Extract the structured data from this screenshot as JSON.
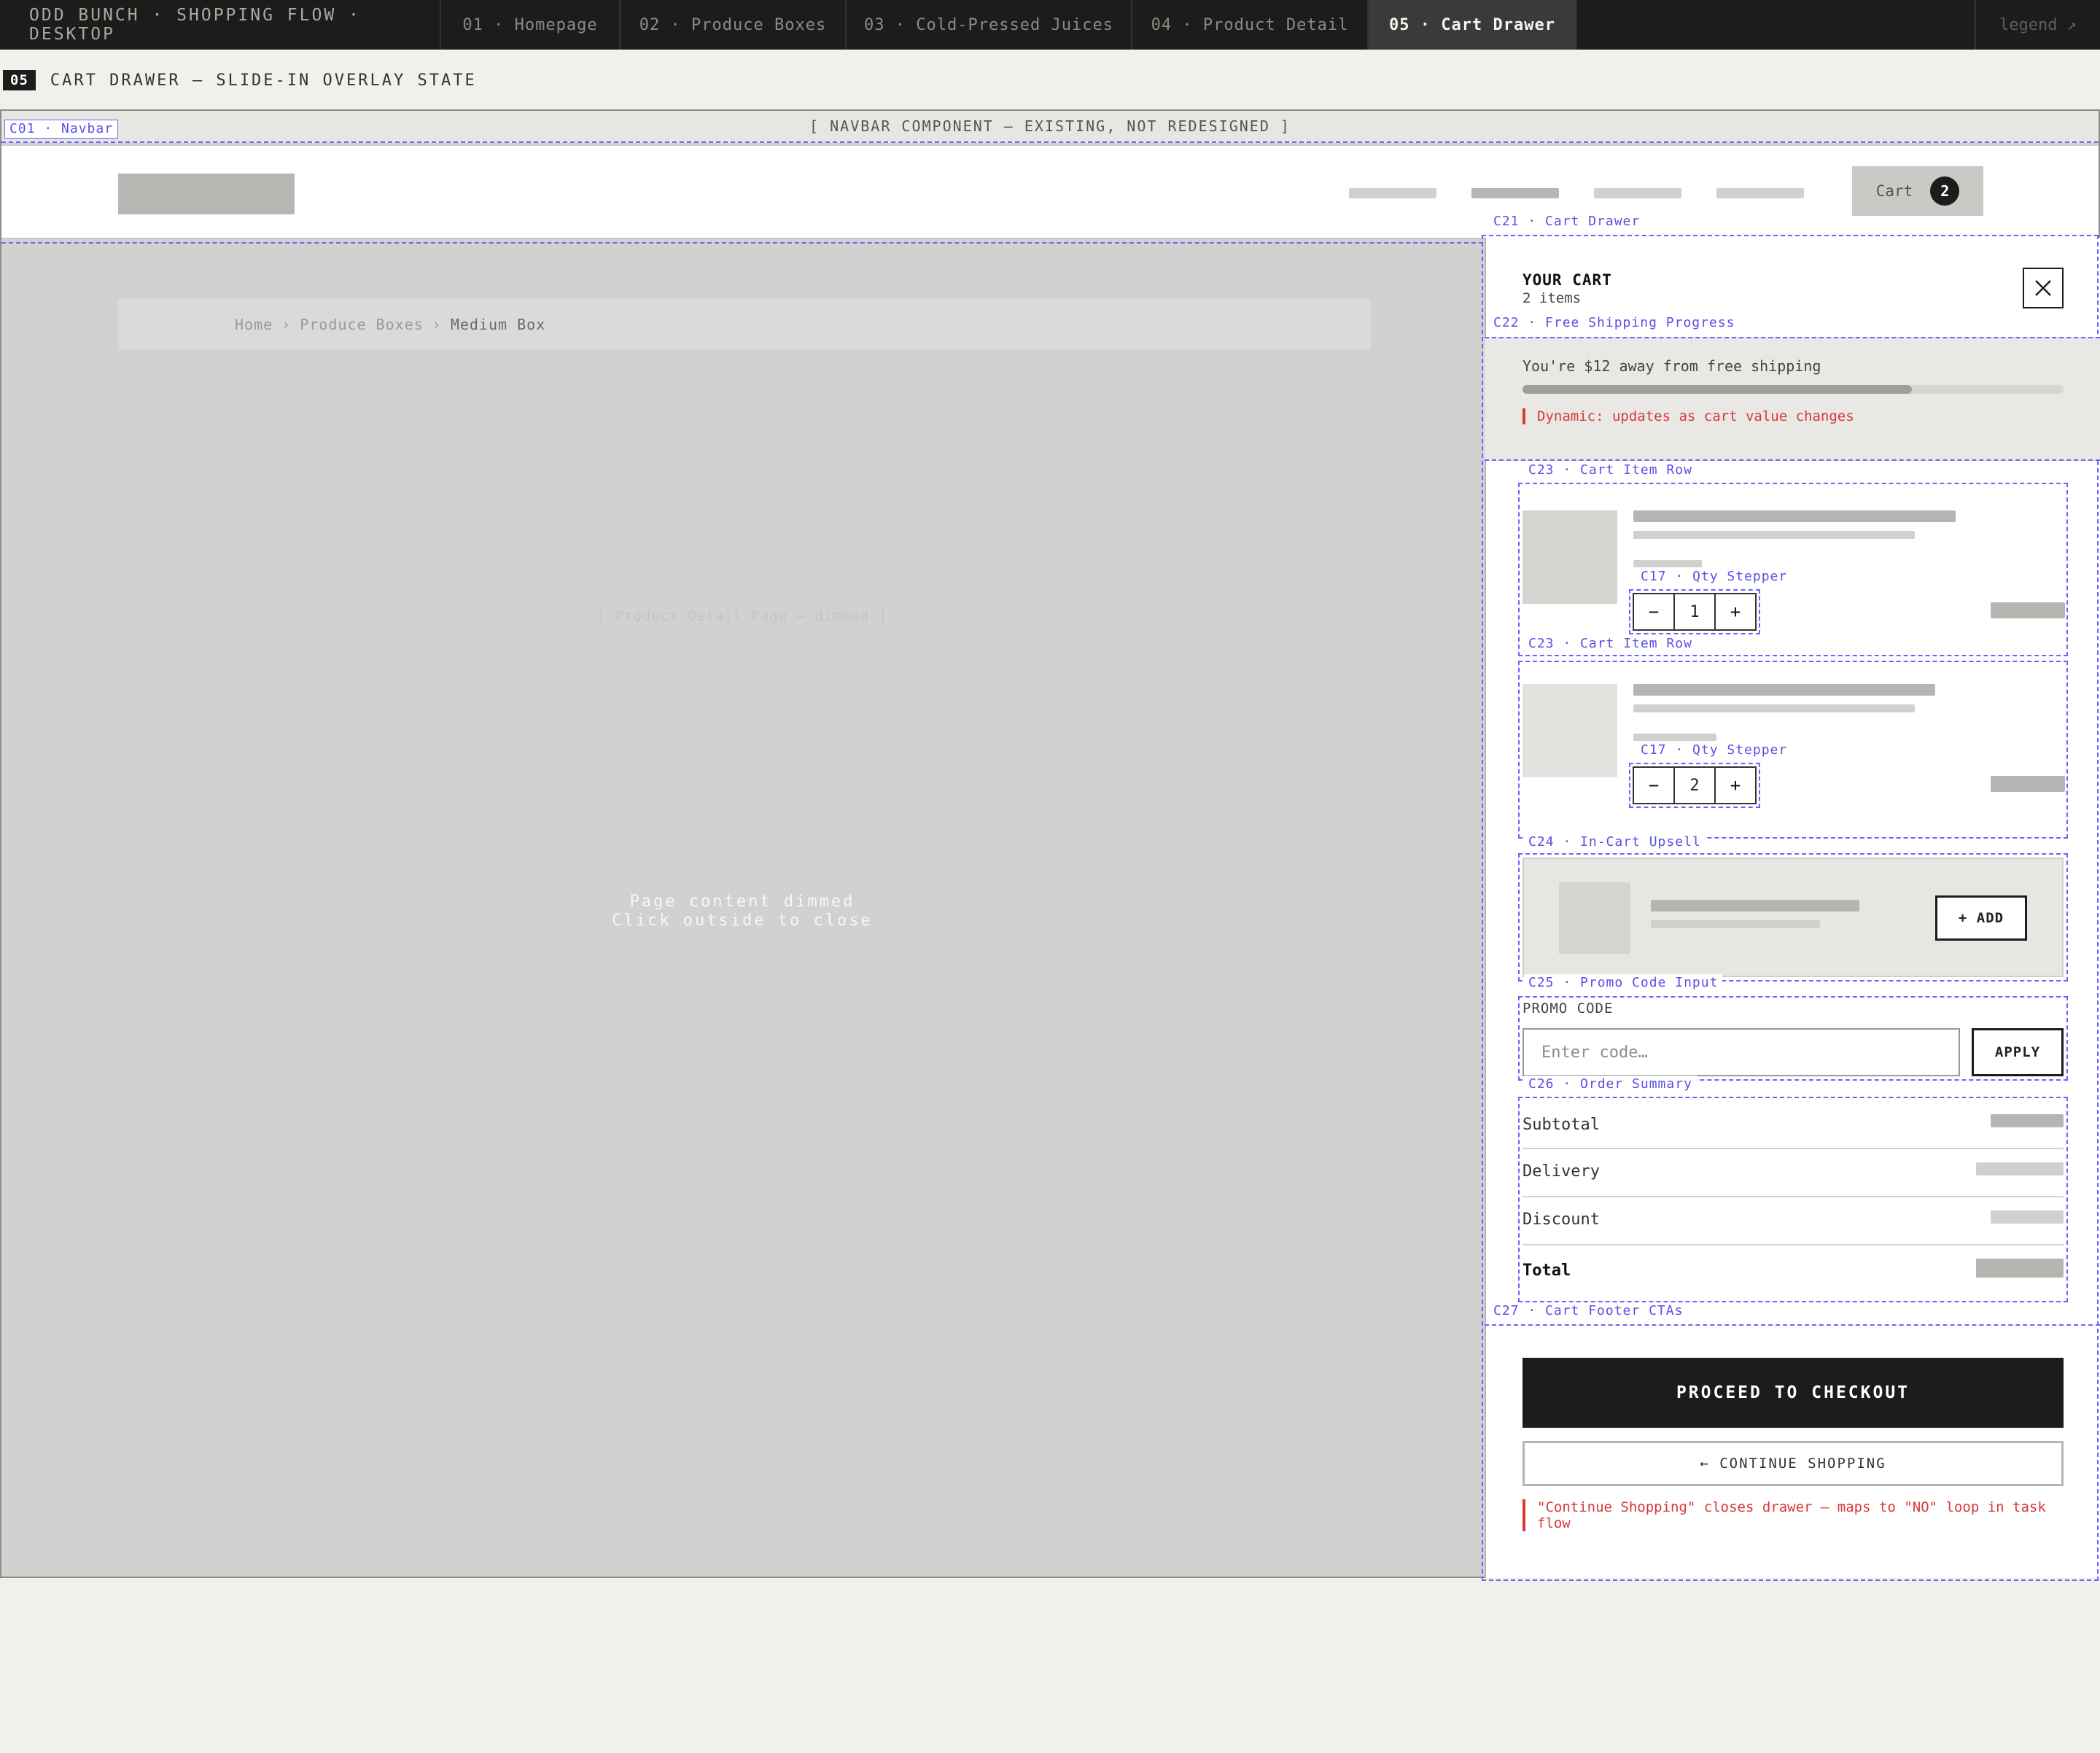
{
  "topbar": {
    "brand": "ODD BUNCH · SHOPPING FLOW · DESKTOP",
    "tabs": [
      {
        "label": "01 · Homepage"
      },
      {
        "label": "02 · Produce Boxes"
      },
      {
        "label": "03 · Cold-Pressed Juices"
      },
      {
        "label": "04 · Product Detail"
      },
      {
        "label": "05 · Cart Drawer"
      }
    ],
    "active_tab": "05 · Cart Drawer",
    "legend": "legend ↗"
  },
  "screen": {
    "number": "05",
    "title": "CART DRAWER — SLIDE-IN OVERLAY STATE"
  },
  "navbar": {
    "tag": "C01 · Navbar",
    "note": "[ NAVBAR COMPONENT — EXISTING, NOT REDESIGNED ]",
    "cart_label": "Cart",
    "cart_count": "2"
  },
  "page": {
    "breadcrumb": [
      "Home",
      "Produce Boxes",
      "Medium Box"
    ],
    "breadcrumb_sep": "›",
    "ghost": "[ Product Detail Page — dimmed ]",
    "dim_line1": "Page content dimmed",
    "dim_line2": "Click outside to close"
  },
  "drawer": {
    "tag": "C21 · Cart Drawer",
    "title": "YOUR CART",
    "subtitle": "2 items",
    "close_icon": "close-icon",
    "shipping": {
      "tag": "C22 · Free Shipping Progress",
      "message": "You're $12 away from free shipping",
      "progress": 0.72,
      "note": "Dynamic: updates as cart value changes"
    },
    "items": [
      {
        "tag": "C23 · Cart Item Row",
        "stepper_tag": "C17 · Qty Stepper",
        "qty": "1"
      },
      {
        "tag": "C23 · Cart Item Row",
        "stepper_tag": "C17 · Qty Stepper",
        "qty": "2"
      }
    ],
    "stepper_minus": "−",
    "stepper_plus": "+",
    "upsell": {
      "tag": "C24 · In-Cart Upsell",
      "add_label": "+ ADD"
    },
    "promo": {
      "tag": "C25 · Promo Code Input",
      "label": "PROMO CODE",
      "placeholder": "Enter code…",
      "apply_label": "APPLY"
    },
    "summary": {
      "tag": "C26 · Order Summary",
      "rows": [
        "Subtotal",
        "Delivery",
        "Discount"
      ],
      "total_label": "Total"
    },
    "footer": {
      "tag": "C27 · Cart Footer CTAs",
      "checkout_label": "PROCEED TO CHECKOUT",
      "continue_label": "← CONTINUE SHOPPING",
      "note": "\"Continue Shopping\" closes drawer — maps to \"NO\" loop in task flow"
    }
  },
  "colors": {
    "accent_dashed": "#6b63ff",
    "note_red": "#d83838",
    "dark": "#1c1c1b"
  }
}
